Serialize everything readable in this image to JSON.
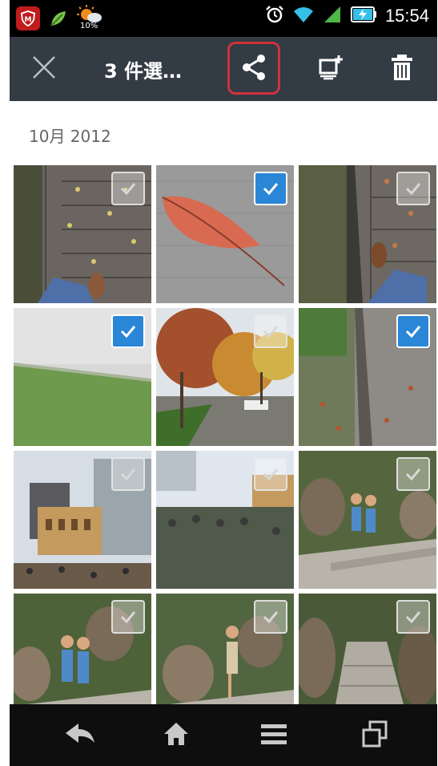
{
  "status_bar": {
    "time": "15:54",
    "weather_percent": "10%",
    "icons": [
      "shield-app-icon",
      "leaf-icon",
      "weather-icon",
      "alarm-icon",
      "wifi-icon",
      "signal-icon",
      "battery-charging-icon"
    ]
  },
  "action_bar": {
    "close_icon": "close-icon",
    "title": "3 件選…",
    "share_icon": "share-icon",
    "add_to_screen_icon": "add-to-screen-icon",
    "delete_icon": "trash-icon",
    "highlight_color": "#d0323a"
  },
  "gallery": {
    "section_label": "10月 2012",
    "photos": [
      {
        "scene": "pavement-leaves-feet",
        "selected": false
      },
      {
        "scene": "red-leaf-on-pavement",
        "selected": true
      },
      {
        "scene": "brick-path-shoes",
        "selected": false
      },
      {
        "scene": "hazy-grass",
        "selected": true
      },
      {
        "scene": "autumn-tree-street",
        "selected": false
      },
      {
        "scene": "stone-curb-leaves",
        "selected": false
      },
      {
        "scene": "campus-buildings",
        "selected": false
      },
      {
        "scene": "park-lawn-people",
        "selected": false
      },
      {
        "scene": "kids-on-stone-steps",
        "selected": false
      },
      {
        "scene": "kids-by-boulder",
        "selected": false
      },
      {
        "scene": "child-on-rock-steps",
        "selected": false
      },
      {
        "scene": "garden-stone-path",
        "selected": false
      }
    ],
    "accent_color": "#2a86d6"
  },
  "nav_bar": {
    "buttons": [
      "back-icon",
      "home-icon",
      "menu-icon",
      "recent-apps-icon"
    ]
  }
}
